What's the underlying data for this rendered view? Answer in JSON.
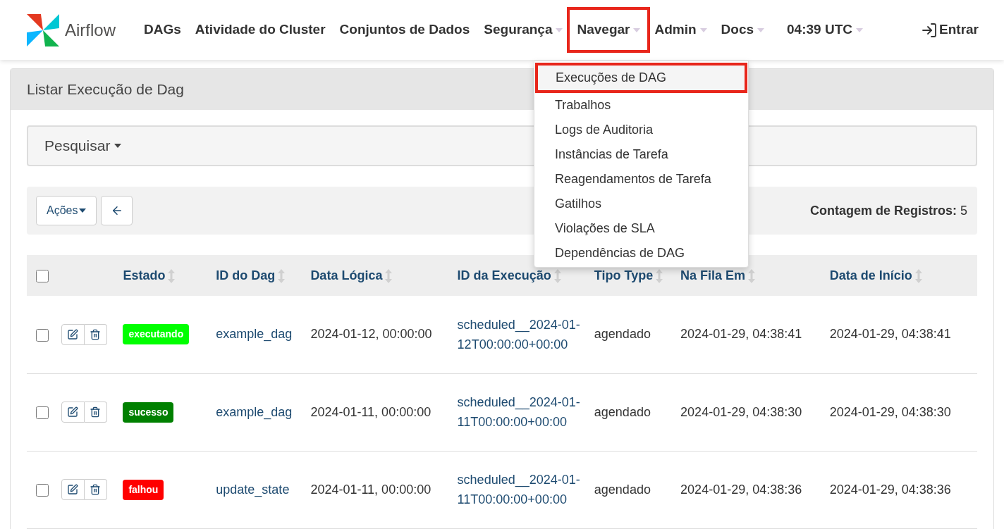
{
  "brand": "Airflow",
  "nav": [
    {
      "label": "DAGs",
      "dropdown": false,
      "highlighted": false
    },
    {
      "label": "Atividade do Cluster",
      "dropdown": false,
      "highlighted": false
    },
    {
      "label": "Conjuntos de Dados",
      "dropdown": false,
      "highlighted": false
    },
    {
      "label": "Segurança",
      "dropdown": true,
      "highlighted": false
    },
    {
      "label": "Navegar",
      "dropdown": true,
      "highlighted": true
    },
    {
      "label": "Admin",
      "dropdown": true,
      "highlighted": false
    },
    {
      "label": "Docs",
      "dropdown": true,
      "highlighted": false
    },
    {
      "label": "04:39 UTC",
      "dropdown": true,
      "highlighted": false
    }
  ],
  "login": "Entrar",
  "menu": [
    {
      "label": "Execuções de DAG",
      "highlighted": true
    },
    {
      "label": "Trabalhos",
      "highlighted": false
    },
    {
      "label": "Logs de Auditoria",
      "highlighted": false
    },
    {
      "label": "Instâncias de Tarefa",
      "highlighted": false
    },
    {
      "label": "Reagendamentos de Tarefa",
      "highlighted": false
    },
    {
      "label": "Gatilhos",
      "highlighted": false
    },
    {
      "label": "Violações de SLA",
      "highlighted": false
    },
    {
      "label": "Dependências de DAG",
      "highlighted": false
    }
  ],
  "panel_title": "Listar Execução de Dag",
  "search": "Pesquisar",
  "actions": "Ações",
  "record_count_label": "Contagem de Registros:",
  "record_count": "5",
  "select_all_checked": false,
  "columns": [
    "Estado",
    "ID do Dag",
    "Data Lógica",
    "ID da Execução",
    "Tipo Type",
    "Na Fila Em",
    "Data de Início"
  ],
  "rows": [
    {
      "checked": false,
      "state": "executando",
      "color": "#00ff00",
      "dag_id": "example_dag",
      "logical_date": "2024-01-12, 00:00:00",
      "run_id": "scheduled__2024-01-12T00:00:00+00:00",
      "type": "agendado",
      "queued_at": "2024-01-29, 04:38:41",
      "start_date": "2024-01-29, 04:38:41"
    },
    {
      "checked": false,
      "state": "sucesso",
      "color": "#008000",
      "dag_id": "example_dag",
      "logical_date": "2024-01-11, 00:00:00",
      "run_id": "scheduled__2024-01-11T00:00:00+00:00",
      "type": "agendado",
      "queued_at": "2024-01-29, 04:38:30",
      "start_date": "2024-01-29, 04:38:30"
    },
    {
      "checked": false,
      "state": "falhou",
      "color": "#ff0000",
      "dag_id": "update_state",
      "logical_date": "2024-01-11, 00:00:00",
      "run_id": "scheduled__2024-01-11T00:00:00+00:00",
      "type": "agendado",
      "queued_at": "2024-01-29, 04:38:36",
      "start_date": "2024-01-29, 04:38:36"
    }
  ]
}
